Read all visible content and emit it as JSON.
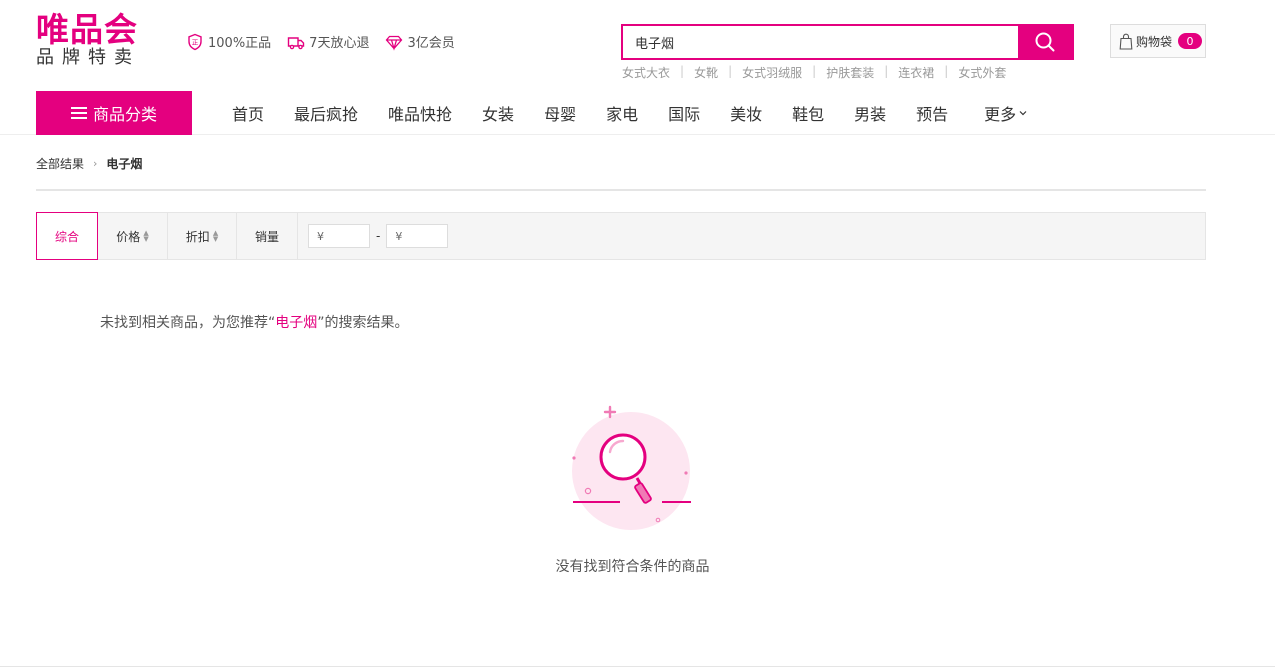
{
  "brand": {
    "logo_main": "唯品会",
    "logo_sub": "品牌特卖",
    "accent_color": "#e4007f"
  },
  "promises": [
    {
      "icon": "shield-icon",
      "label": "100%正品"
    },
    {
      "icon": "truck-icon",
      "label": "7天放心退"
    },
    {
      "icon": "diamond-icon",
      "label": "3亿会员"
    }
  ],
  "search": {
    "value": "电子烟",
    "button_icon": "search-icon"
  },
  "hot_words": [
    "女式大衣",
    "女靴",
    "女式羽绒服",
    "护肤套装",
    "连衣裙",
    "女式外套"
  ],
  "cart": {
    "label": "购物袋",
    "count": "0",
    "icon": "shopping-bag-icon"
  },
  "nav": {
    "category_button": "商品分类",
    "items": [
      "首页",
      "最后疯抢",
      "唯品快抢",
      "女装",
      "母婴",
      "家电",
      "国际",
      "美妆",
      "鞋包",
      "男装",
      "预告"
    ],
    "more": "更多"
  },
  "breadcrumb": {
    "root": "全部结果",
    "current": "电子烟"
  },
  "sort": {
    "tabs": [
      "综合",
      "价格",
      "折扣",
      "销量"
    ],
    "active": "综合",
    "price_min_placeholder": "¥",
    "price_max_placeholder": "¥",
    "range_separator": "-"
  },
  "result": {
    "tip_prefix": "未找到相关商品，为您推荐“",
    "tip_keyword": "电子烟",
    "tip_suffix": "”的搜索结果。",
    "empty_text": "没有找到符合条件的商品",
    "empty_icon": "magnifier-empty-icon"
  }
}
